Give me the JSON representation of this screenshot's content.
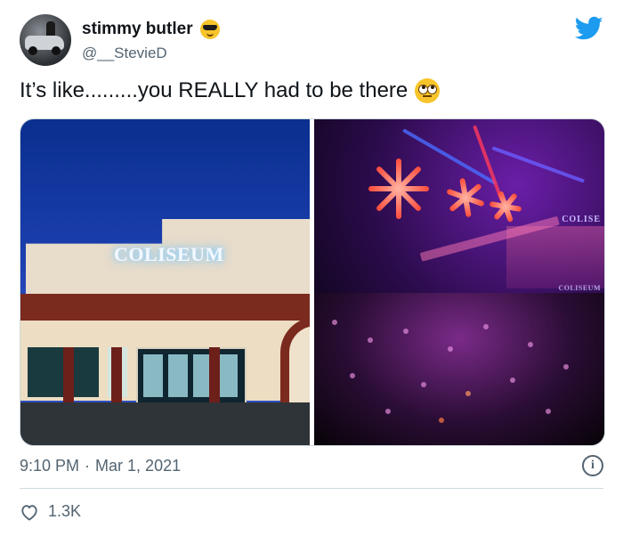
{
  "tweet": {
    "display_name": "stimmy butler",
    "name_emoji": "smiling-face-with-sunglasses-emoji",
    "handle": "@__StevieD",
    "text": "It’s like.........you REALLY had to be there",
    "text_emoji": "face-with-rolling-eyes-emoji",
    "media": {
      "left_sign": "COLISEUM",
      "right_sign_top": "COLISE",
      "right_sign_bottom": "COLISEUM"
    },
    "time": "9:10 PM",
    "separator": "·",
    "date": "Mar 1, 2021",
    "likes": "1.3K"
  },
  "icons": {
    "logo": "twitter-bird-icon",
    "info": "info-icon",
    "like": "heart-icon"
  },
  "colors": {
    "brand": "#1d9bf0",
    "text_primary": "#0f1419",
    "text_secondary": "#536471",
    "divider": "#cfd9de"
  }
}
